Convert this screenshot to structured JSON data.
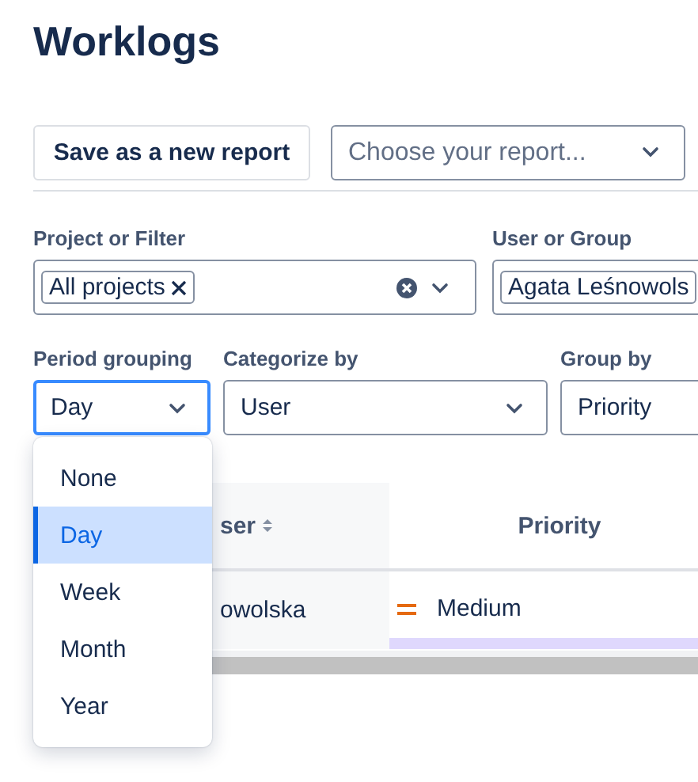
{
  "title": "Worklogs",
  "toolbar": {
    "save_button": "Save as a new report",
    "report_select": {
      "placeholder": "Choose your report..."
    }
  },
  "filters": [
    {
      "label": "Project or Filter",
      "tags": [
        {
          "label": "All projects",
          "removable": true
        }
      ],
      "clearable": true
    },
    {
      "label": "User or Group",
      "tags": [
        {
          "label": "Agata Leśnowols",
          "removable": false
        }
      ],
      "clearable": false
    }
  ],
  "options": [
    {
      "label": "Period grouping",
      "value": "Day",
      "focused": true
    },
    {
      "label": "Categorize by",
      "value": "User",
      "focused": false
    },
    {
      "label": "Group by",
      "value": "Priority",
      "focused": false
    }
  ],
  "table": {
    "columns": [
      {
        "label": "ser",
        "sortable": true
      },
      {
        "label": "Priority",
        "sortable": false
      }
    ],
    "rows": [
      [
        {
          "kind": "text",
          "text": "owolska"
        },
        {
          "kind": "priority",
          "text": "Medium"
        }
      ]
    ]
  },
  "dropdown": {
    "items": [
      {
        "label": "None",
        "selected": false
      },
      {
        "label": "Day",
        "selected": true
      },
      {
        "label": "Week",
        "selected": false
      },
      {
        "label": "Month",
        "selected": false
      },
      {
        "label": "Year",
        "selected": false
      }
    ]
  }
}
